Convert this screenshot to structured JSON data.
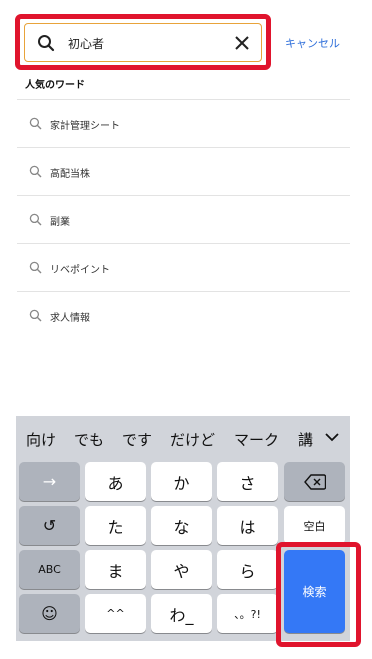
{
  "search": {
    "value": "初心者",
    "cancel_label": "キャンセル"
  },
  "popular": {
    "title": "人気のワード",
    "items": [
      {
        "label": "家計管理シート"
      },
      {
        "label": "高配当株"
      },
      {
        "label": "副業"
      },
      {
        "label": "リベポイント"
      },
      {
        "label": "求人情報"
      }
    ]
  },
  "keyboard": {
    "candidates": [
      "向け",
      "でも",
      "です",
      "だけど",
      "マーク",
      "講"
    ],
    "keys": {
      "arrow": "→",
      "a": "あ",
      "ka": "か",
      "sa": "さ",
      "undo": "↺",
      "ta": "た",
      "na": "な",
      "ha": "は",
      "space": "空白",
      "abc": "ABC",
      "ma": "ま",
      "ya": "や",
      "ra": "ら",
      "emoji": "☺",
      "dakuten": "^^",
      "wa": "わ_",
      "punct": "、。?!",
      "search": "検索"
    }
  },
  "colors": {
    "accent_blue": "#3478f6",
    "annotation_red": "#e0142d",
    "search_border": "#e8a33a"
  }
}
